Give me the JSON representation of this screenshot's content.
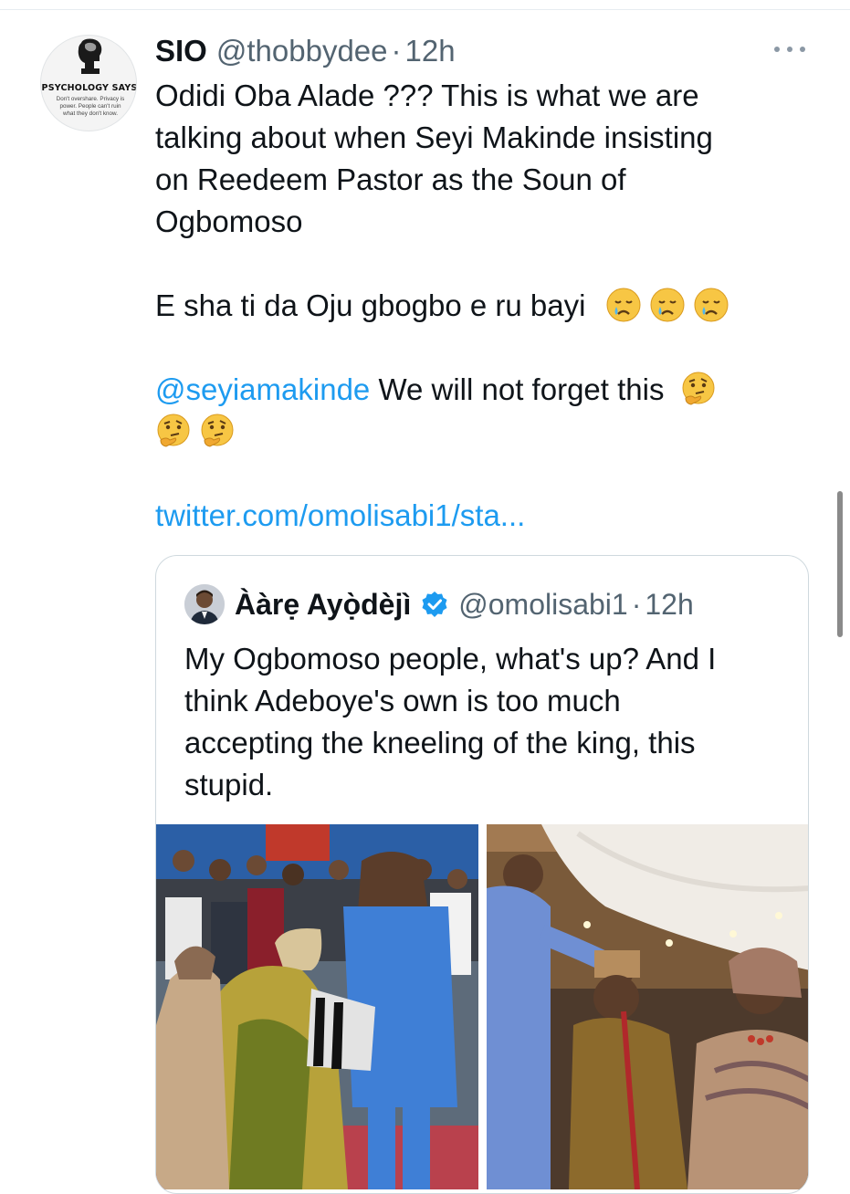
{
  "tweet": {
    "author_name": "SIO",
    "author_handle": "@thobbydee",
    "time": "12h",
    "dot": "·",
    "avatar": {
      "brand_text": "PSYCHOLOGY SAYS",
      "quote_text": "Don't overshare. Privacy is power. People can't ruin what they don't know."
    },
    "lines": [
      "Odidi Oba Alade ???  This is what we are",
      "talking about when Seyi Makinde insisting",
      "on Reedeem Pastor as the Soun of",
      "Ogbomoso"
    ],
    "para2": "E sha ti da Oju gbogbo e ru bayi",
    "mention": "@seyiamakinde",
    "para3": " We will not forget this",
    "link": "twitter.com/omolisabi1/sta...",
    "icons": {
      "more": "more-icon",
      "crying": "crying-face-emoji",
      "thinking": "thinking-face-emoji"
    }
  },
  "quoted": {
    "author_name": "Ààrẹ Ayọ̀dèjì",
    "author_handle": "@omolisabi1",
    "time": "12h",
    "dot": "·",
    "text_lines": [
      "My Ogbomoso people, what's up? And I",
      "think Adeboye's own is too much",
      "accepting the kneeling of the king, this",
      "stupid."
    ],
    "media": [
      "photo-left",
      "photo-right"
    ]
  },
  "colors": {
    "link": "#1d9bf0",
    "muted": "#536471",
    "text": "#0f1419",
    "border": "#cfd9de"
  }
}
